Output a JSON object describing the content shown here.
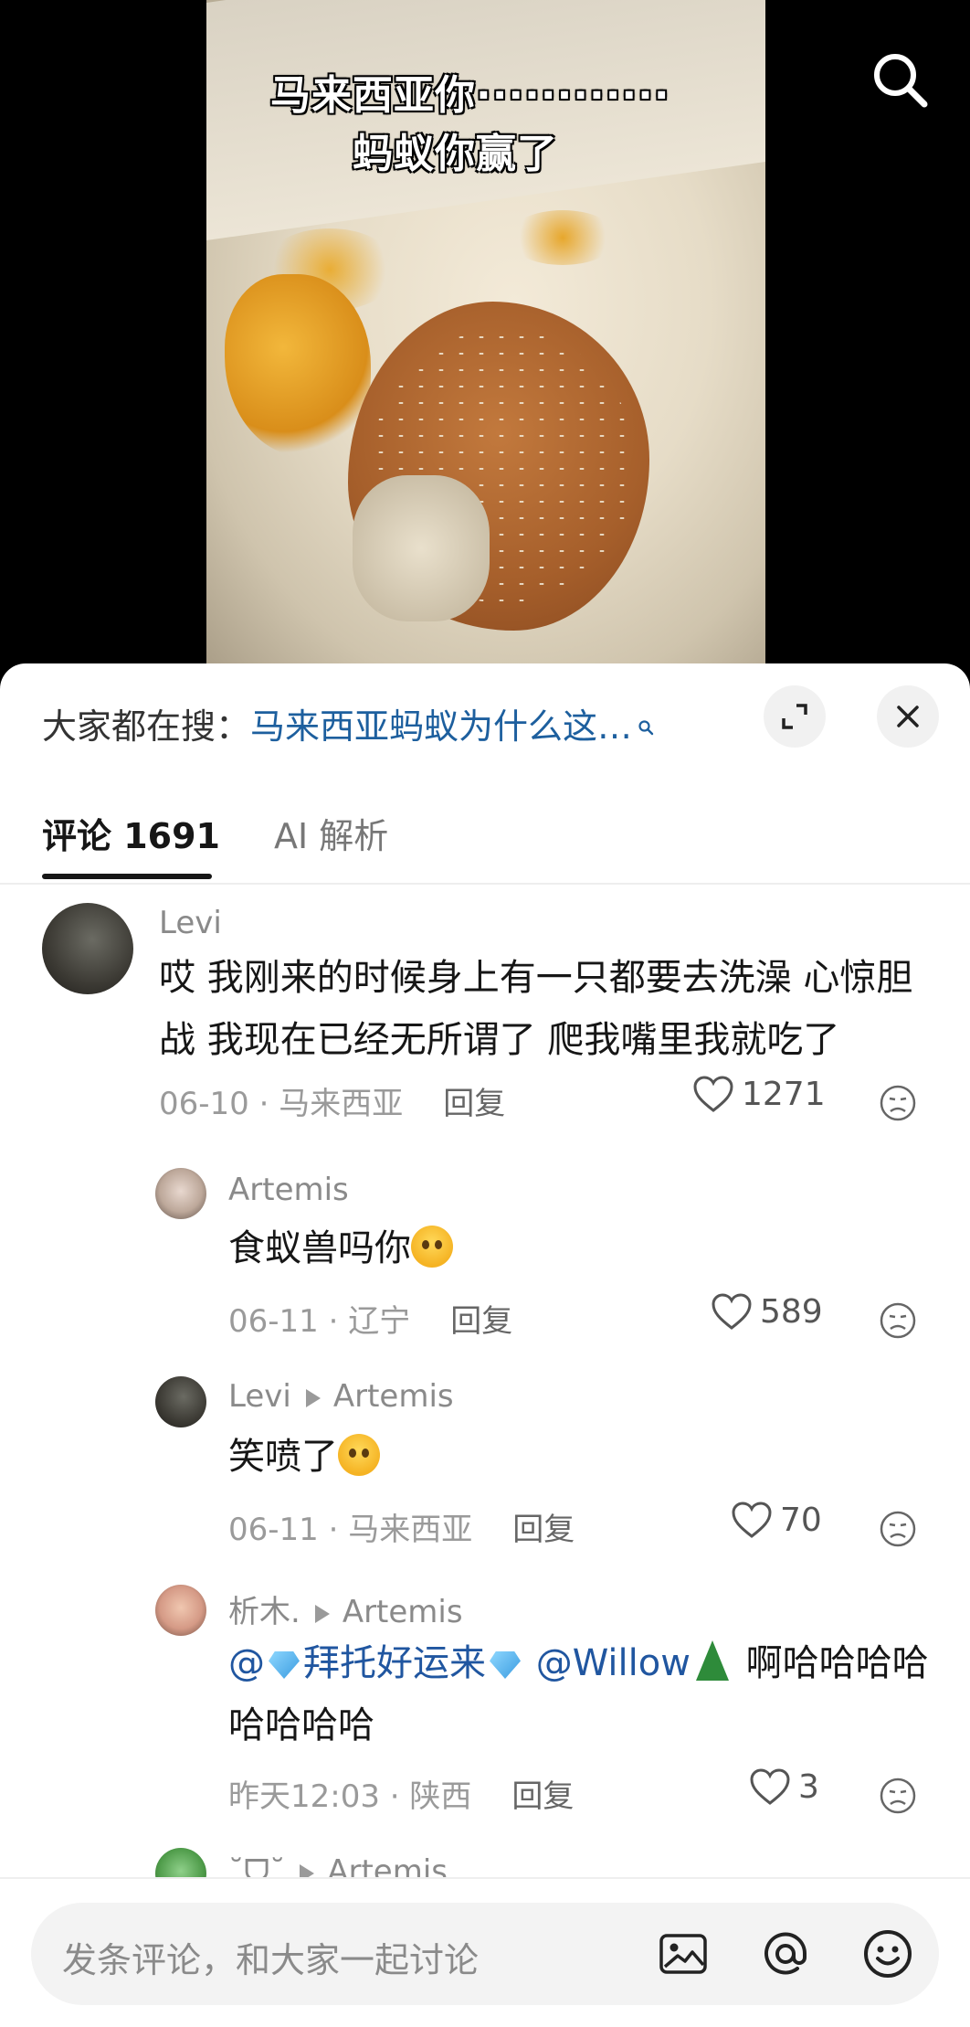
{
  "video": {
    "caption_line1": "马来西亚你············",
    "caption_line2": "蚂蚁你赢了"
  },
  "sheet": {
    "hot_search_label": "大家都在搜：",
    "hot_search_keyword": "马来西亚蚂蚁为什么这…",
    "tabs": [
      {
        "label": "评论 1691"
      },
      {
        "label": "AI 解析"
      }
    ]
  },
  "comments": [
    {
      "user": "Levi",
      "text": "哎 我刚来的时候身上有一只都要去洗澡 心惊胆战 我现在已经无所谓了 爬我嘴里我就吃了",
      "date_location": "06-10 · 马来西亚",
      "reply_label": "回复",
      "likes": "1271"
    },
    {
      "user": "Artemis",
      "text": "食蚁兽吗你",
      "date_location": "06-11 · 辽宁",
      "reply_label": "回复",
      "likes": "589"
    },
    {
      "user": "Levi",
      "reply_to": "Artemis",
      "text": "笑喷了",
      "date_location": "06-11 · 马来西亚",
      "reply_label": "回复",
      "likes": "70"
    },
    {
      "user": "析木.",
      "reply_to": "Artemis",
      "text_mention1": "@",
      "text_mention1_name": "拜托好运来",
      "text_mention2": "@Willow",
      "text_rest": " 啊哈哈哈哈哈哈哈哈",
      "date_location": "昨天12:03 · 陕西",
      "reply_label": "回复",
      "likes": "3"
    },
    {
      "user": "˘ᗜ˘",
      "reply_to": "Artemis"
    }
  ],
  "bottom_bar": {
    "placeholder": "发条评论，和大家一起讨论"
  },
  "icons": [
    "search-icon",
    "expand-icon",
    "close-icon",
    "heart-icon",
    "dislike-icon",
    "image-icon",
    "at-icon",
    "emoji-icon"
  ]
}
